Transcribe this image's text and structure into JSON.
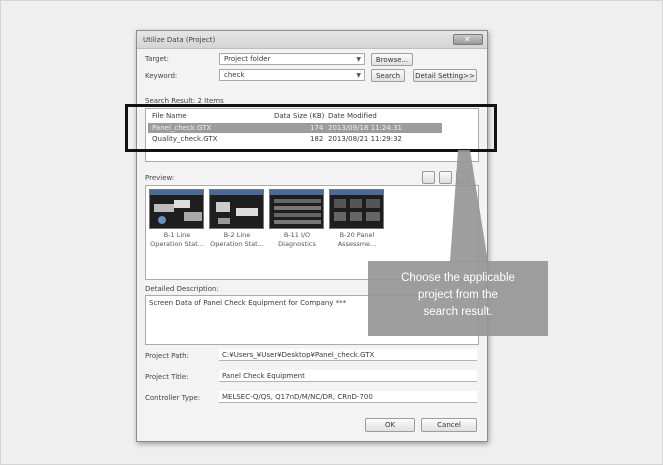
{
  "dialog": {
    "title": "Utilize Data (Project)",
    "close_glyph": "✕",
    "target_label": "Target:",
    "target_value": "Project folder",
    "browse_label": "Browse...",
    "keyword_label": "Keyword:",
    "keyword_value": "check",
    "search_label": "Search",
    "detail_label": "Detail Setting>>",
    "result_label": "Search Result: 2 Items",
    "columns": [
      "File Name",
      "Data Size (KB)",
      "Date Modified"
    ],
    "rows": [
      {
        "name": "Panel_check.GTX",
        "size": "174",
        "date": "2013/09/18 11:24:31"
      },
      {
        "name": "Quality_check.GTX",
        "size": "182",
        "date": "2013/08/21 11:29:32"
      }
    ],
    "preview_label": "Preview:",
    "thumbs": [
      {
        "l1": "B-1 Line",
        "l2": "Operation Stat..."
      },
      {
        "l1": "B-2 Line",
        "l2": "Operation Stat..."
      },
      {
        "l1": "B-11 I/O",
        "l2": "Diagnostics"
      },
      {
        "l1": "B-20 Panel",
        "l2": "Assessme..."
      }
    ],
    "desc_label": "Detailed Description:",
    "desc_value": "Screen Data of Panel Check Equipment for Company ***",
    "path_label": "Project Path:",
    "path_value": "C:¥Users_¥User¥Desktop¥Panel_check.GTX",
    "ptitle_label": "Project Title:",
    "ptitle_value": "Panel Check Equipment",
    "ctype_label": "Controller Type:",
    "ctype_value": "MELSEC-Q/QS, Q17nD/M/NC/DR, CRnD-700",
    "ok_label": "OK",
    "cancel_label": "Cancel"
  },
  "callout": {
    "line1": "Choose the applicable",
    "line2": "project from the",
    "line3": "search result."
  },
  "colors": {
    "callout_bg": "#969696",
    "highlight_border": "#111111",
    "selected_row": "#9c9c9c"
  }
}
